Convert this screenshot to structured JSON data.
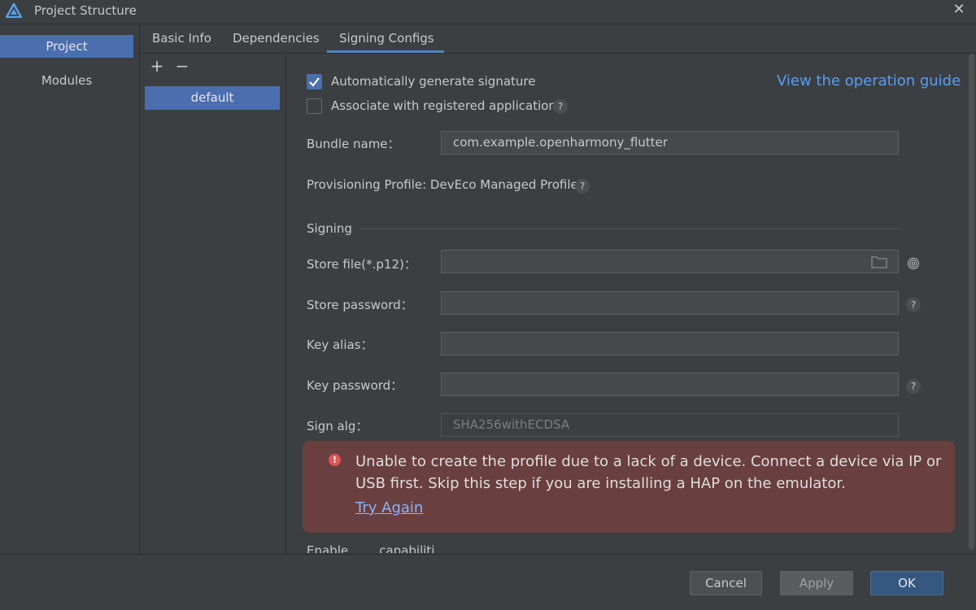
{
  "window": {
    "title": "Project Structure",
    "close_icon": "close-icon"
  },
  "sidebar": {
    "items": [
      {
        "label": "Project",
        "selected": true
      },
      {
        "label": "Modules",
        "selected": false
      }
    ]
  },
  "tabs": [
    {
      "label": "Basic Info"
    },
    {
      "label": "Dependencies"
    },
    {
      "label": "Signing Configs",
      "active": true
    }
  ],
  "configs": {
    "add_label": "+",
    "remove_label": "−",
    "items": [
      "default"
    ]
  },
  "form": {
    "auto_sign_label": "Automatically generate signature",
    "auto_sign_checked": true,
    "assoc_label": "Associate with registered application",
    "assoc_checked": false,
    "operation_guide": "View the operation guide",
    "bundle_label": "Bundle name：",
    "bundle_value": "com.example.openharmony_flutter",
    "profile_label": "Provisioning Profile: DevEco Managed Profile",
    "signing_section": "Signing",
    "store_file_label": "Store file(*.p12)：",
    "store_password_label": "Store password：",
    "key_alias_label": "Key alias：",
    "key_password_label": "Key password：",
    "sign_alg_label": "Sign alg：",
    "sign_alg_value": "SHA256withECDSA",
    "help_glyph": "?",
    "cut_label": "Enable ...... capabiliti"
  },
  "error": {
    "icon_glyph": "!",
    "message": "Unable to create the profile due to a lack of a device. Connect a device via IP or USB first. Skip this step if you are installing a HAP on the emulator.",
    "retry_label": "Try Again"
  },
  "buttons": {
    "cancel": "Cancel",
    "apply": "Apply",
    "ok": "OK"
  },
  "colors": {
    "accent": "#4b6eaf",
    "link": "#589df6",
    "error_bg": "#6a3f3f",
    "error_icon": "#e05555"
  }
}
